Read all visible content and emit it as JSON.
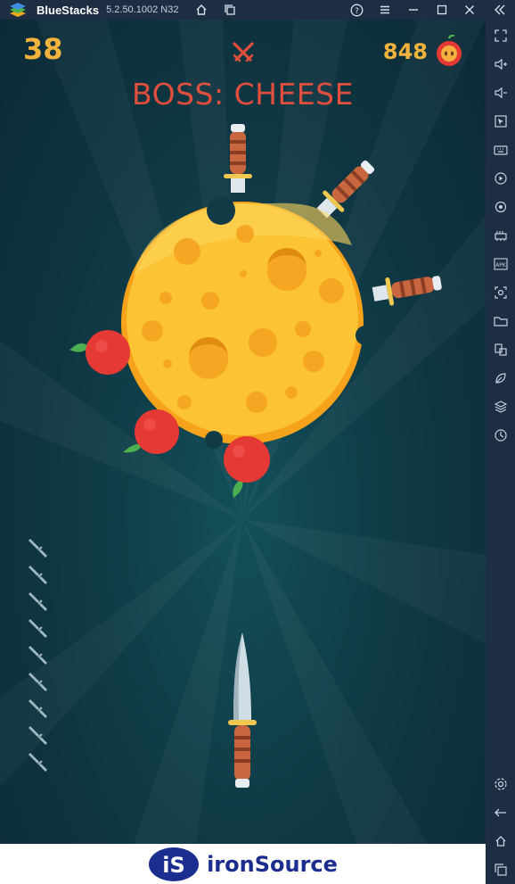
{
  "window": {
    "app_name": "BlueStacks",
    "version": "5.2.50.1002 N32"
  },
  "hud": {
    "level": "38",
    "apples": "848",
    "boss_title": "BOSS: CHEESE",
    "knives_remaining": 9
  },
  "ad": {
    "logo_letters": "iS",
    "brand": "ironSource"
  },
  "sidebar": {
    "icons": [
      "fullscreen-icon",
      "volume-up-icon",
      "volume-down-icon",
      "pointer-icon",
      "keyboard-icon",
      "record-icon",
      "location-icon",
      "performance-icon",
      "apk-icon",
      "screenshot-icon",
      "folder-icon",
      "multi-instance-icon",
      "eco-mode-icon",
      "layers-icon",
      "macro-icon"
    ],
    "bottom_icons": [
      "settings-icon",
      "back-icon",
      "home-icon",
      "recent-apps-icon"
    ]
  },
  "colors": {
    "hud_gold": "#f2b33d",
    "boss_red": "#e04e3d",
    "cheese": "#fbc02d",
    "titlebar": "#1d2d44"
  }
}
